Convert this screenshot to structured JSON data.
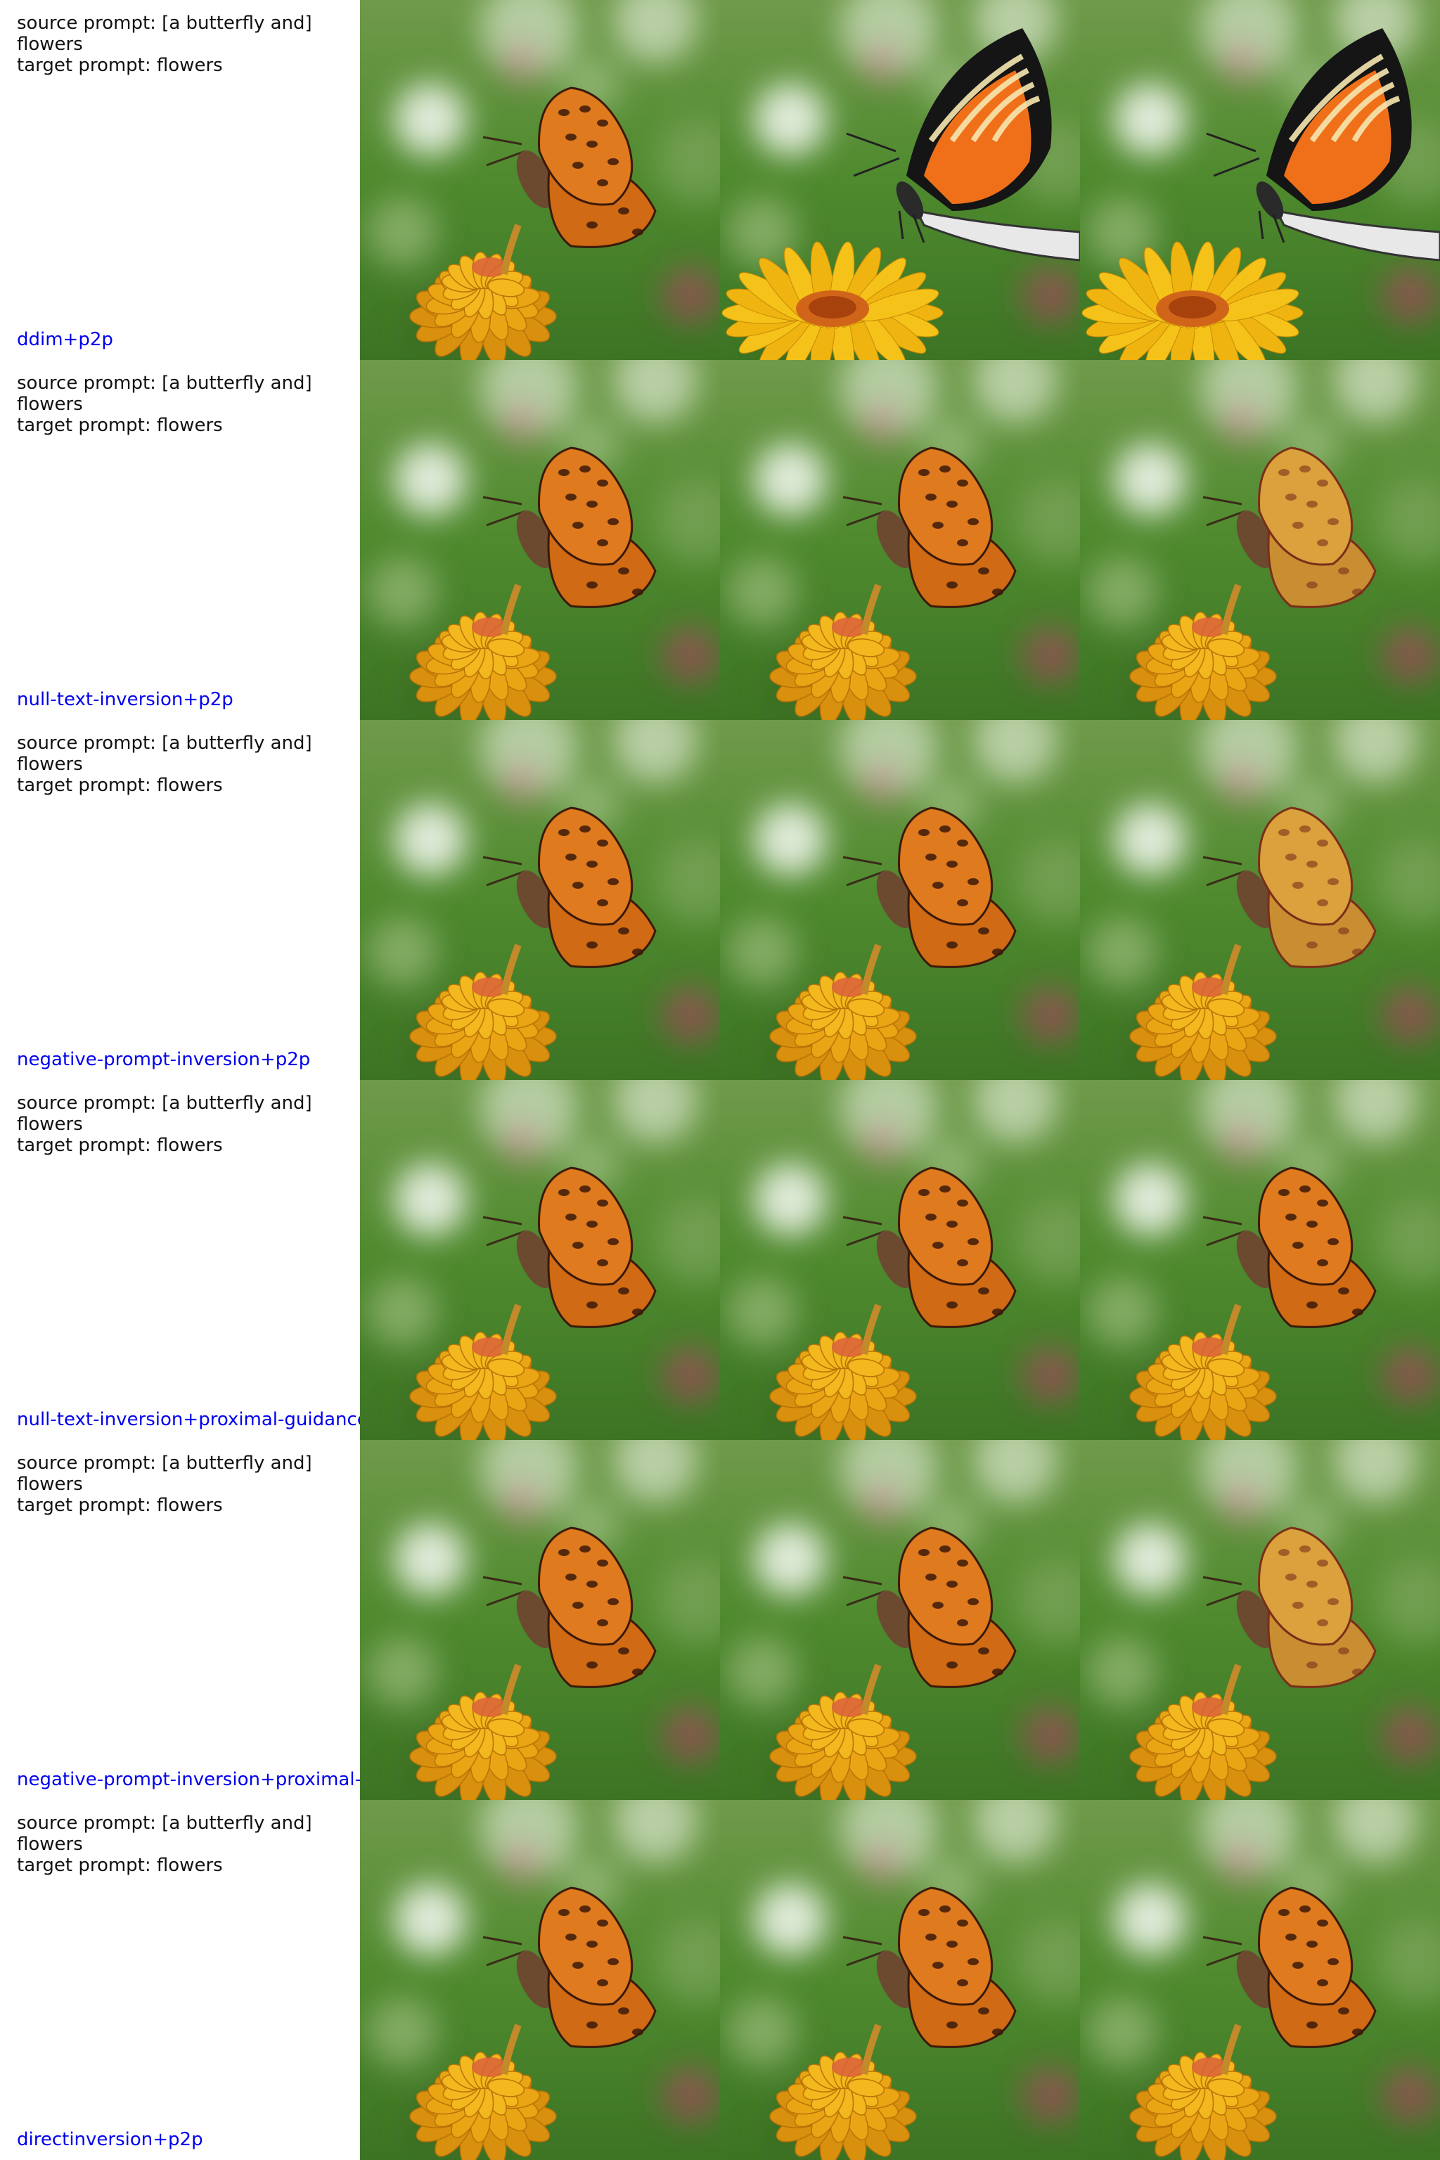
{
  "accent_color": "#0000ee",
  "rows": [
    {
      "source_prompt": "source prompt: [a butterfly and] flowers",
      "target_prompt": "target prompt: flowers",
      "method": "ddim+p2p",
      "cells": [
        {
          "subject": "fritillary-butterfly",
          "flower": "zinnia"
        },
        {
          "subject": "swallowtail-butterfly",
          "flower": "daisy"
        },
        {
          "subject": "swallowtail-butterfly",
          "flower": "daisy"
        }
      ]
    },
    {
      "source_prompt": "source prompt: [a butterfly and] flowers",
      "target_prompt": "target prompt: flowers",
      "method": "null-text-inversion+p2p",
      "cells": [
        {
          "subject": "fritillary-butterfly",
          "flower": "zinnia"
        },
        {
          "subject": "fritillary-butterfly",
          "flower": "zinnia"
        },
        {
          "subject": "faded-butterfly",
          "flower": "zinnia"
        }
      ]
    },
    {
      "source_prompt": "source prompt: [a butterfly and] flowers",
      "target_prompt": "target prompt: flowers",
      "method": "negative-prompt-inversion+p2p",
      "cells": [
        {
          "subject": "fritillary-butterfly",
          "flower": "zinnia"
        },
        {
          "subject": "fritillary-butterfly",
          "flower": "zinnia"
        },
        {
          "subject": "faded-butterfly",
          "flower": "zinnia"
        }
      ]
    },
    {
      "source_prompt": "source prompt: [a butterfly and] flowers",
      "target_prompt": "target prompt: flowers",
      "method": "null-text-inversion+proximal-guidance",
      "cells": [
        {
          "subject": "fritillary-butterfly",
          "flower": "zinnia"
        },
        {
          "subject": "fritillary-butterfly",
          "flower": "zinnia"
        },
        {
          "subject": "fritillary-butterfly",
          "flower": "zinnia"
        }
      ]
    },
    {
      "source_prompt": "source prompt: [a butterfly and] flowers",
      "target_prompt": "target prompt: flowers",
      "method": "negative-prompt-inversion+proximal-guidance",
      "cells": [
        {
          "subject": "fritillary-butterfly",
          "flower": "zinnia"
        },
        {
          "subject": "fritillary-butterfly",
          "flower": "zinnia"
        },
        {
          "subject": "faded-butterfly",
          "flower": "zinnia"
        }
      ]
    },
    {
      "source_prompt": "source prompt: [a butterfly and] flowers",
      "target_prompt": "target prompt: flowers",
      "method": "directinversion+p2p",
      "cells": [
        {
          "subject": "fritillary-butterfly",
          "flower": "zinnia"
        },
        {
          "subject": "fritillary-butterfly",
          "flower": "zinnia"
        },
        {
          "subject": "fritillary-butterfly",
          "flower": "zinnia"
        }
      ]
    }
  ]
}
